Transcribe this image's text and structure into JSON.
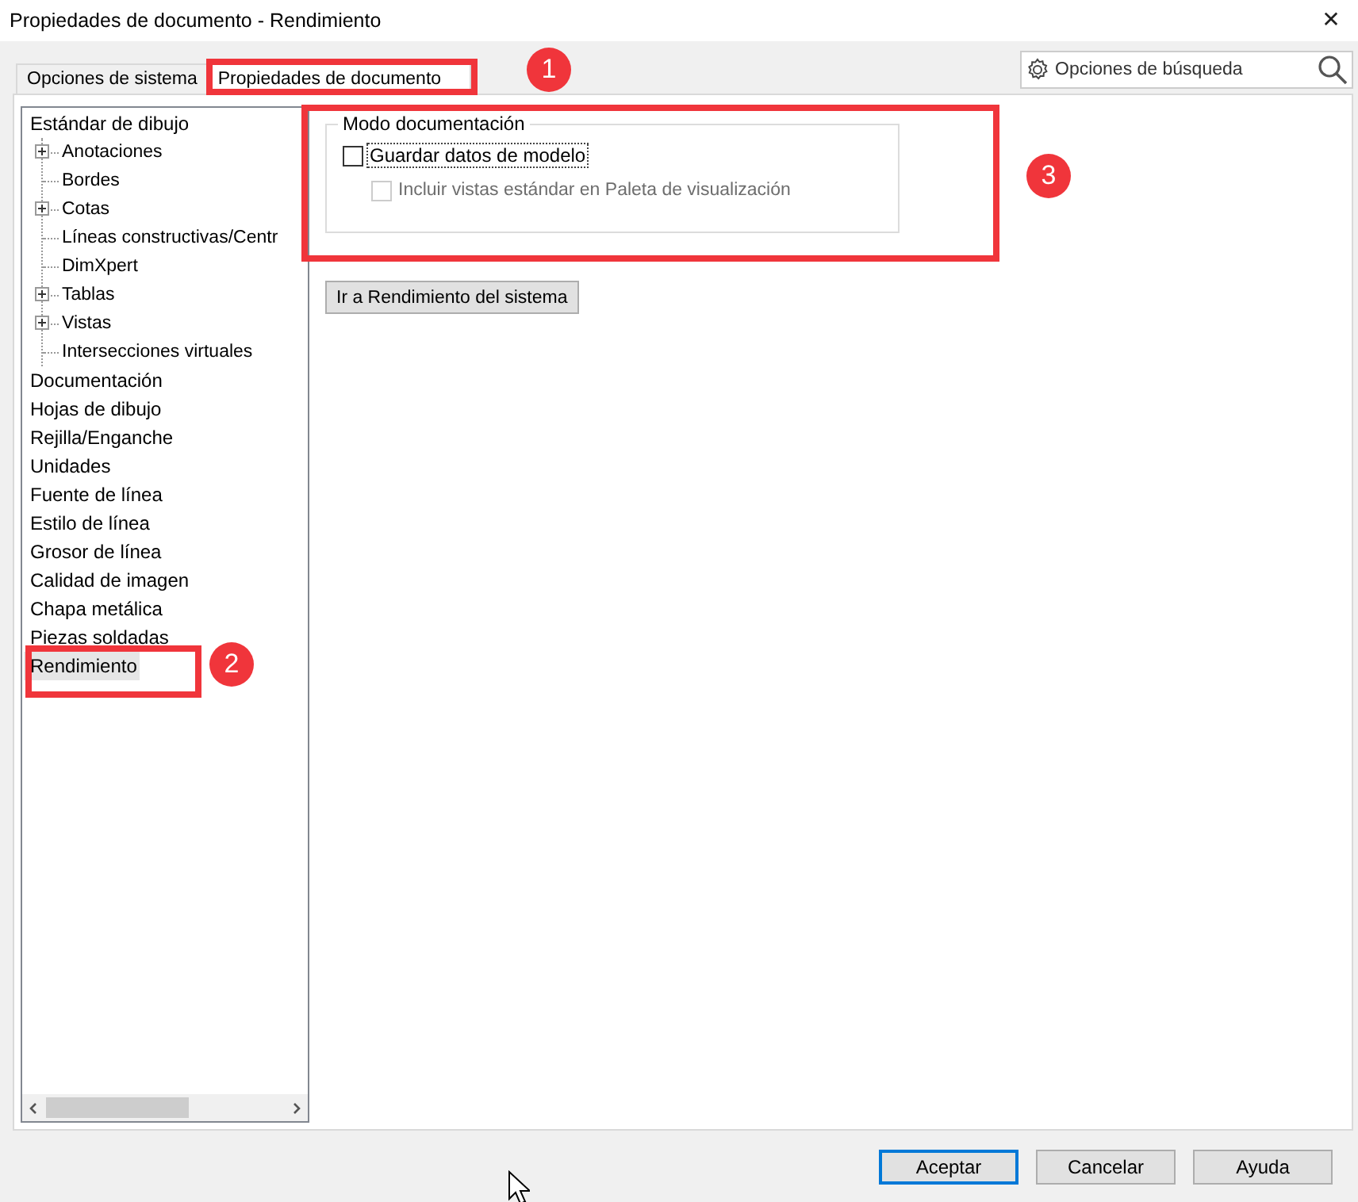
{
  "window": {
    "title": "Propiedades de documento - Rendimiento",
    "close": "✕"
  },
  "tabs": [
    {
      "label": "Opciones de sistema",
      "selected": false
    },
    {
      "label": "Propiedades de documento",
      "selected": true
    }
  ],
  "search": {
    "placeholder": "Opciones de búsqueda"
  },
  "tree": [
    {
      "label": "Estándar de dibujo",
      "selected": false,
      "children": [
        {
          "label": "Anotaciones",
          "kind": "folder",
          "expanded": false
        },
        {
          "label": "Bordes",
          "kind": "leaf"
        },
        {
          "label": "Cotas",
          "kind": "folder",
          "expanded": false
        },
        {
          "label": "Líneas constructivas/Centr",
          "kind": "leaf"
        },
        {
          "label": "DimXpert",
          "kind": "leaf"
        },
        {
          "label": "Tablas",
          "kind": "folder",
          "expanded": false
        },
        {
          "label": "Vistas",
          "kind": "folder",
          "expanded": false
        },
        {
          "label": "Intersecciones virtuales",
          "kind": "leaf"
        }
      ]
    },
    {
      "label": "Documentación",
      "selected": false
    },
    {
      "label": "Hojas de dibujo",
      "selected": false
    },
    {
      "label": "Rejilla/Enganche",
      "selected": false
    },
    {
      "label": "Unidades",
      "selected": false
    },
    {
      "label": "Fuente de línea",
      "selected": false
    },
    {
      "label": "Estilo de línea",
      "selected": false
    },
    {
      "label": "Grosor de línea",
      "selected": false
    },
    {
      "label": "Calidad de imagen",
      "selected": false
    },
    {
      "label": "Chapa metálica",
      "selected": false
    },
    {
      "label": "Piezas soldadas",
      "selected": false
    },
    {
      "label": "Rendimiento",
      "selected": true
    }
  ],
  "group": {
    "title": "Modo documentación",
    "options": [
      {
        "label": "Guardar datos de modelo",
        "checked": false,
        "disabled": false,
        "focused": true
      },
      {
        "label": "Incluir vistas estándar en Paleta de visualización",
        "checked": false,
        "disabled": true,
        "focused": false
      }
    ]
  },
  "system_button": "Ir a Rendimiento del sistema",
  "buttons": [
    {
      "label": "Aceptar",
      "default": true
    },
    {
      "label": "Cancelar",
      "default": false
    },
    {
      "label": "Ayuda",
      "default": false
    }
  ],
  "annotations": [
    {
      "number": "1"
    },
    {
      "number": "2"
    },
    {
      "number": "3"
    }
  ]
}
